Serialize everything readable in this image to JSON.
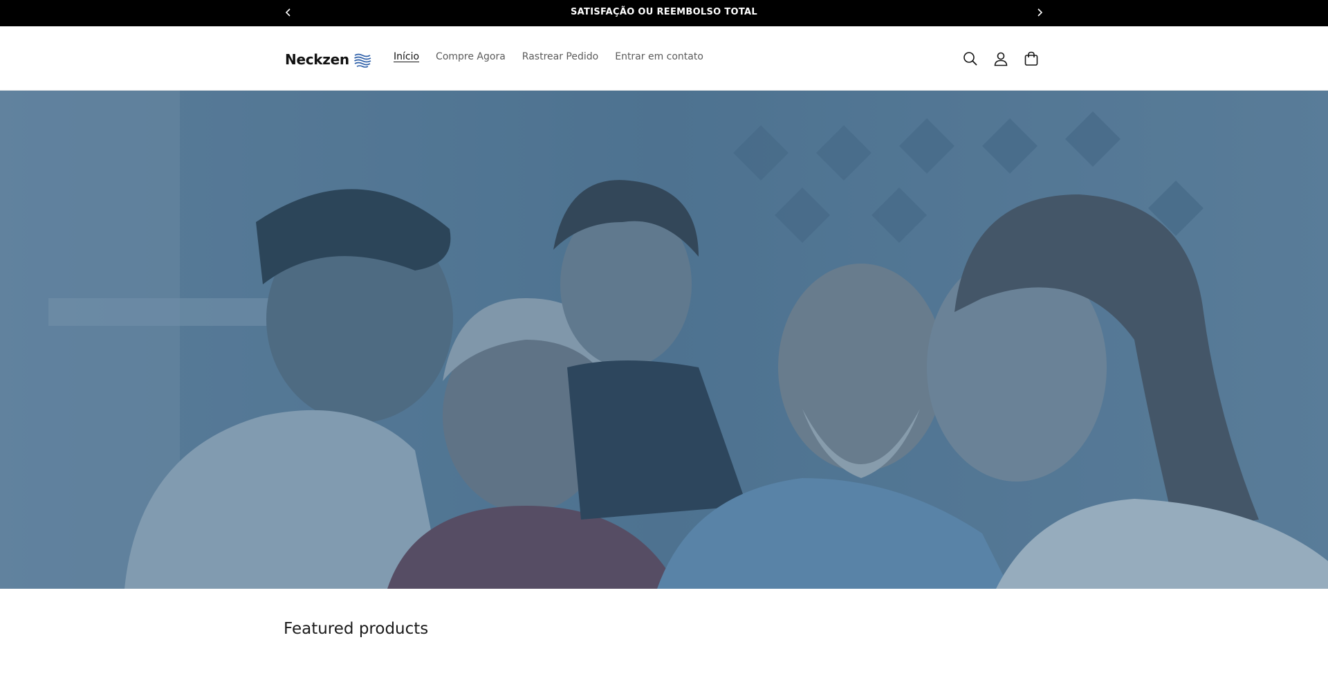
{
  "announcement": {
    "message": "SATISFAÇÃO OU REEMBOLSO TOTAL"
  },
  "header": {
    "logo_text": "Neckzen",
    "nav": [
      {
        "label": "Início",
        "active": true
      },
      {
        "label": "Compre Agora",
        "active": false
      },
      {
        "label": "Rastrear Pedido",
        "active": false
      },
      {
        "label": "Entrar em contato",
        "active": false
      }
    ],
    "icons": [
      "search-icon",
      "account-icon",
      "cart-icon"
    ]
  },
  "hero": {
    "image": "family-group-photo",
    "overlay_color": "#3f6585"
  },
  "featured": {
    "title": "Featured products"
  },
  "colors": {
    "announcement_bg": "#000000",
    "text": "#121212",
    "nav_text": "#5a5a5a",
    "logo_wave": "#2c5ea8"
  }
}
